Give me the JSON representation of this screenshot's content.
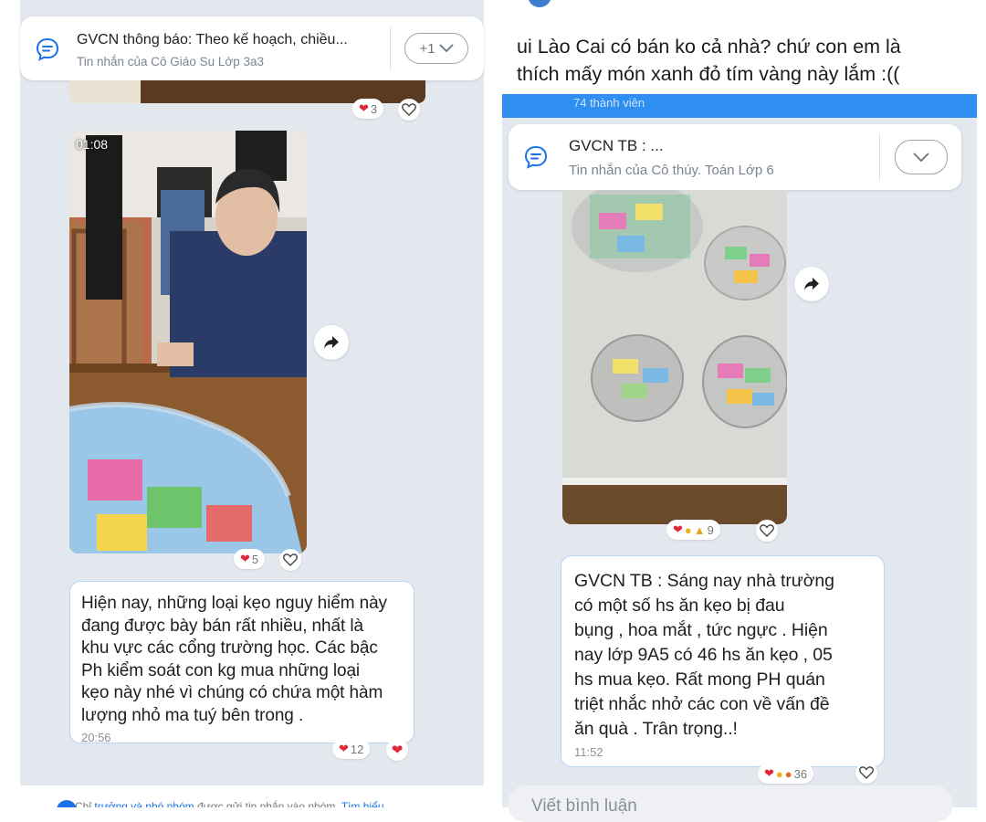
{
  "left": {
    "pinned": {
      "title": "GVCN thông báo: Theo kế hoạch, chiều...",
      "subtitle": "Tin nhắn của Cô Giáo Su Lớp 3a3",
      "more_badge": "+1"
    },
    "top_reaction_count": "3",
    "video": {
      "duration": "01:08",
      "reaction_count": "5"
    },
    "message": {
      "lines": [
        "Hiện nay, những loại kẹo nguy hiểm này",
        "đang được bày bán rất nhiều, nhất là",
        "khu vực các cổng trường học. Các bậc",
        "Ph kiểm soát con kg mua những loại",
        "kẹo này nhé vì chúng có chứa một hàm",
        "lượng nhỏ ma tuý bên trong ."
      ],
      "time": "20:56",
      "reaction_count": "12"
    },
    "footer": {
      "prefix": "Chỉ",
      "link1": "trưởng và phó nhóm",
      "middle": "được gửi tin nhắn vào nhóm.",
      "link2": "Tìm hiểu"
    }
  },
  "right": {
    "caption_lines": [
      "ui Lào Cai có bán ko cả nhà? chứ con em là",
      "thích mấy món xanh đỏ tím vàng này lắm :(("
    ],
    "members_text": "74 thành viên",
    "pinned": {
      "title": "GVCN TB : ...",
      "subtitle": "Tin nhắn của Cô thúy. Toán Lớp 6"
    },
    "photo_reaction_count": "9",
    "message": {
      "lines": [
        "GVCN TB : Sáng nay nhà trường",
        "có một số hs ăn kẹo bị đau",
        "bụng , hoa mắt , tức ngực . Hiện",
        "nay lớp 9A5 có 46 hs ăn kẹo , 05",
        "hs mua kẹo. Rất mong PH quán",
        "triệt nhắc nhở các con về vấn đề",
        "ăn quà . Trân trọng..!"
      ],
      "time": "11:52",
      "reaction_count": "36"
    },
    "comment_placeholder": "Viết bình luận"
  },
  "colors": {
    "accent": "#2e8ff0",
    "chat_bg": "#e3e8ef",
    "bubble_border": "#b5d5f3",
    "heart": "#e0283a"
  }
}
